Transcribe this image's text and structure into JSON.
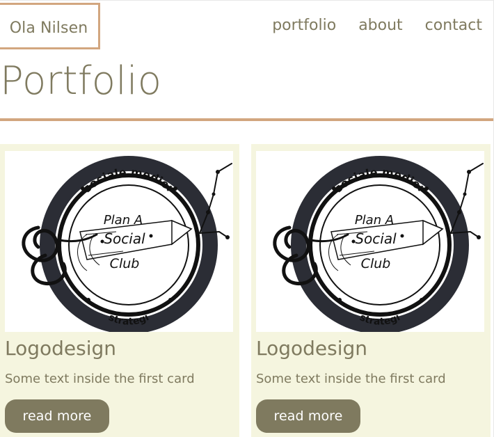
{
  "header": {
    "logo_text": "Ola Nilsen",
    "nav": [
      "portfolio",
      "about",
      "contact"
    ]
  },
  "page": {
    "title": "Portfolio"
  },
  "cards": [
    {
      "title": "Logodesign",
      "text": "Some text inside the first card",
      "button_label": "read more",
      "image_text": {
        "top": "sosiale medier",
        "bottom": "strategi",
        "line1": "Plan A",
        "line2": "Social",
        "line3": "Club"
      }
    },
    {
      "title": "Logodesign",
      "text": "Some text inside the first card",
      "button_label": "read more",
      "image_text": {
        "top": "sosiale medier",
        "bottom": "strategi",
        "line1": "Plan A",
        "line2": "Social",
        "line3": "Club"
      }
    }
  ],
  "colors": {
    "accent": "#d2a67f",
    "text": "#7f7a5f",
    "card_bg": "#f5f5df",
    "button_bg": "#7f7a5f"
  }
}
